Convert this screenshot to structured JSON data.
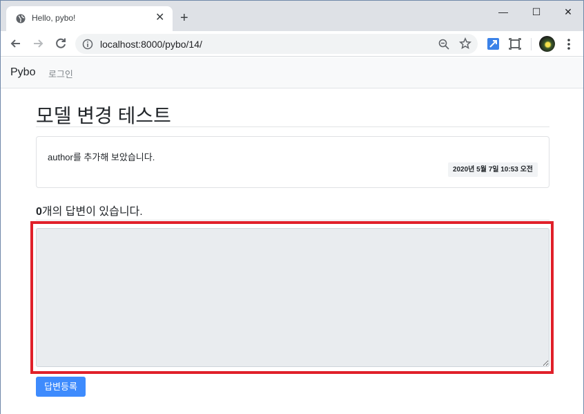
{
  "browser": {
    "tab_title": "Hello, pybo!",
    "tab_close_glyph": "✕",
    "new_tab_glyph": "+",
    "window_controls": {
      "minimize": "—",
      "maximize": "☐",
      "close": "✕"
    },
    "url": "localhost:8000/pybo/14/",
    "icons": [
      "globe-icon",
      "back-icon",
      "forward-icon",
      "reload-icon",
      "info-icon",
      "zoom-out-icon",
      "star-icon",
      "extension-icon",
      "cast-icon",
      "profile-avatar",
      "kebab-menu-icon"
    ]
  },
  "navbar": {
    "brand": "Pybo",
    "login": "로그인"
  },
  "question": {
    "subject": "모델 변경 테스트",
    "content": "author를 추가해 보았습니다.",
    "create_date": "2020년 5월 7일 10:53 오전"
  },
  "answers": {
    "count": "0",
    "count_suffix": "개의 답변이 있습니다.",
    "textarea_value": "",
    "submit_label": "답변등록"
  },
  "colors": {
    "primary": "#3e8bfd",
    "highlight": "#e0202a",
    "textarea_bg": "#e9ecef"
  }
}
